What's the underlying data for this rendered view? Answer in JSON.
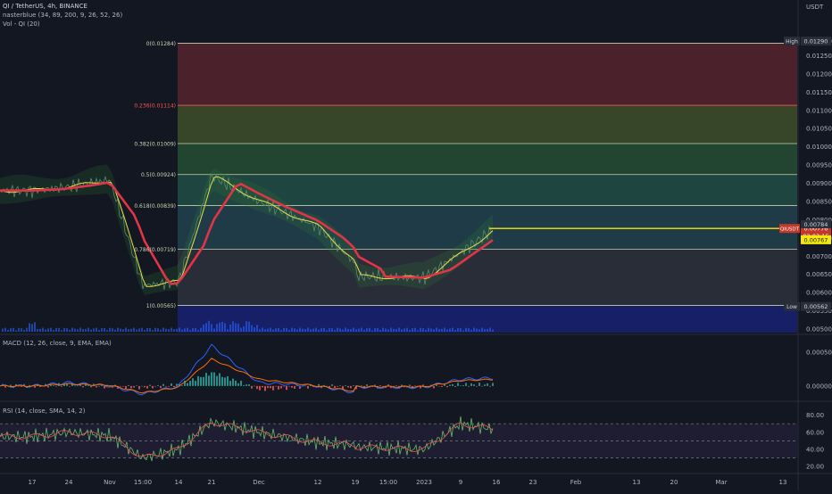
{
  "header": {
    "symbol_line": "QI / TetherUS, 4h, BINANCE",
    "indicator_line": "nasterblue (34, 89, 200, 9, 26, 52, 26)",
    "volume_line": "Vol - QI (20)",
    "currency": "USDT"
  },
  "macd_panel": {
    "label": "MACD (12, 26, close, 9, EMA, EMA)"
  },
  "rsi_panel": {
    "label": "RSI (14, close, SMA, 14, 2)"
  },
  "colors": {
    "background": "#131722",
    "fib_line": "#c9d3b0",
    "fib_0236": "#ff5252",
    "price_line": "#f5e90a",
    "ma_red": "#e13447",
    "ma_yellow": "#e7dd4a",
    "macd_line": "#2962ff",
    "signal_line": "#ff6d00",
    "rsi_line": "#7e57c2"
  },
  "chart_data": [
    {
      "type": "line",
      "title": "",
      "y_scale": "linear",
      "ylim": [
        0.005,
        0.01305
      ],
      "x_ticks": [
        "17",
        "24",
        "Nov",
        "15:00",
        "14",
        "21",
        "Dec",
        "12",
        "19",
        "15:00",
        "2023",
        "9",
        "16",
        "23",
        "Feb",
        "13",
        "20",
        "Mar",
        "13"
      ],
      "y_ticks": [
        "0.01290",
        "0.01250",
        "0.01200",
        "0.01150",
        "0.01100",
        "0.01050",
        "0.01000",
        "0.00950",
        "0.00900",
        "0.00850",
        "0.00800",
        "0.00750",
        "0.00700",
        "0.00650",
        "0.00600",
        "0.00550",
        "0.00500"
      ],
      "fibonacci": [
        {
          "level": "0",
          "price": 0.01284,
          "label": "0(0.01284)"
        },
        {
          "level": "0.236",
          "price": 0.01114,
          "label": "0.236(0.01114)"
        },
        {
          "level": "0.382",
          "price": 0.01009,
          "label": "0.382(0.01009)"
        },
        {
          "level": "0.5",
          "price": 0.00924,
          "label": "0.5(0.00924)"
        },
        {
          "level": "0.618",
          "price": 0.00839,
          "label": "0.618(0.00839)"
        },
        {
          "level": "0.786",
          "price": 0.00719,
          "label": "0.786(0.00719)"
        },
        {
          "level": "1",
          "price": 0.00565,
          "label": "1(0.00565)"
        }
      ],
      "price_badges": [
        {
          "label": "High",
          "value": "0.01290",
          "price": 0.0129
        },
        {
          "label": "Low",
          "value": "0.00562",
          "price": 0.00562
        },
        {
          "label": "QIUSDT",
          "value": "0.00776",
          "price": 0.00776,
          "countdown": "02:03:15"
        },
        {
          "label": "",
          "value": "0.00784",
          "price": 0.00784
        },
        {
          "label": "",
          "value": "0.00767",
          "price": 0.00767
        }
      ],
      "series": [
        {
          "name": "QIUSDT",
          "x": [
            "17",
            "24",
            "Nov",
            "15:00",
            "14",
            "21",
            "Dec",
            "12",
            "19",
            "15:00",
            "2023",
            "9",
            "16"
          ],
          "values": [
            0.0088,
            0.0089,
            0.0091,
            0.0062,
            0.0063,
            0.0092,
            0.0085,
            0.0078,
            0.0068,
            0.0066,
            0.0064,
            0.0071,
            0.0078
          ]
        }
      ]
    },
    {
      "type": "line",
      "title": "MACD (12, 26, close, 9, EMA, EMA)",
      "ylim": [
        -0.0002,
        0.0007
      ],
      "y_ticks": [
        "0.00050",
        "0.00000"
      ],
      "series": [
        {
          "name": "MACD",
          "values": [
            0.0,
            5e-05,
            0.0,
            -0.00012,
            0.0,
            0.0006,
            5e-05,
            0.0,
            -0.0001,
            0.0,
            -2e-05,
            0.0001,
            0.00012
          ]
        },
        {
          "name": "Signal",
          "values": [
            0.0,
            3e-05,
            1e-05,
            -0.0001,
            -2e-05,
            0.0004,
            0.0001,
            0.0,
            -8e-05,
            -1e-05,
            -1e-05,
            8e-05,
            0.0001
          ]
        }
      ]
    },
    {
      "type": "line",
      "title": "RSI (14, close, SMA, 14, 2)",
      "ylim": [
        15,
        90
      ],
      "y_ticks": [
        "80.00",
        "60.00",
        "40.00",
        "20.00"
      ],
      "bands": [
        70,
        50,
        30
      ],
      "series": [
        {
          "name": "RSI",
          "values": [
            55,
            60,
            56,
            30,
            40,
            72,
            60,
            48,
            45,
            52,
            40,
            70,
            63
          ]
        }
      ]
    }
  ]
}
